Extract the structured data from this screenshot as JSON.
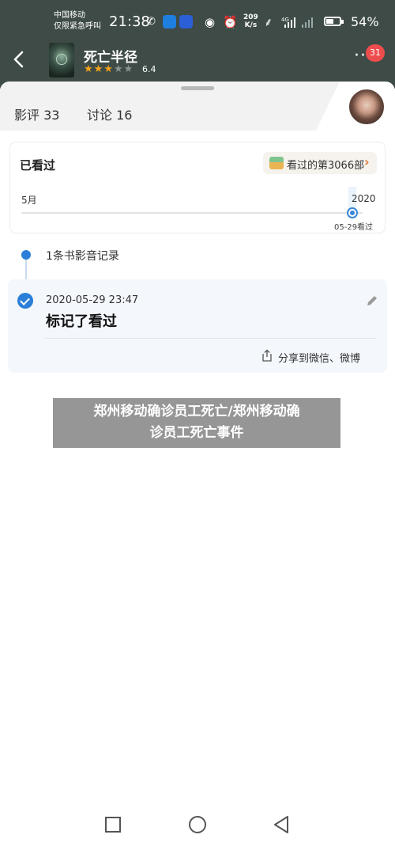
{
  "status_bar": {
    "carrier_line1": "中国移动",
    "carrier_line2": "仅限紧急呼叫",
    "time": "21:38",
    "net_speed_value": "209",
    "net_speed_unit": "K/s",
    "signal_label": "4G",
    "battery_percent": "54%",
    "battery_level": 0.54
  },
  "header": {
    "title": "死亡半径",
    "stars_filled": 3,
    "stars_total": 5,
    "rating": "6.4",
    "notification_count": "31",
    "back_icon": "chevron-left-icon",
    "more_icon": "more-dots-icon"
  },
  "tabs": [
    {
      "label": "影评 33"
    },
    {
      "label": "讨论 16"
    }
  ],
  "watched": {
    "title": "已看过",
    "count_label": "看过的第3066部",
    "timeline_start": "5月",
    "timeline_end": "2020",
    "marker_date": "05-29看过"
  },
  "records": {
    "header": "1条书影音记录",
    "entry": {
      "time": "2020-05-29 23:47",
      "text": "标记了看过",
      "share_label": "分享到微信、微博"
    }
  },
  "watermark": {
    "line1": "郑州移动确诊员工死亡/郑州移动确",
    "line2": "诊员工死亡事件"
  },
  "colors": {
    "header_bg": "#3e4b46",
    "accent_blue": "#2b7fd8",
    "star": "#f2a31a",
    "badge_red": "#ee4d4d"
  }
}
